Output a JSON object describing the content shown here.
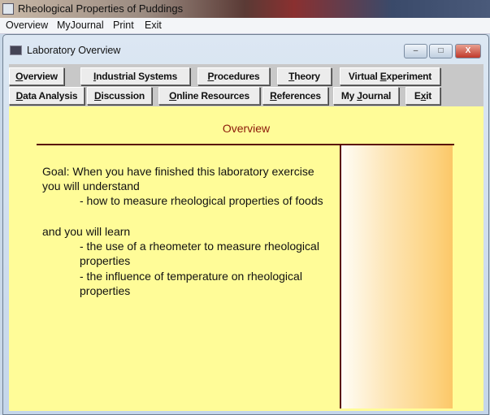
{
  "app": {
    "title": "Rheological Properties of Puddings",
    "icon": "app-icon"
  },
  "menu": [
    "Overview",
    "MyJournal",
    "Print",
    "Exit"
  ],
  "window": {
    "title": "Laboratory Overview",
    "controls": {
      "minimize": "–",
      "maximize": "□",
      "close": "X"
    }
  },
  "buttons": {
    "row1": [
      {
        "pre": "",
        "key": "O",
        "post": "verview"
      },
      {
        "pre": "",
        "key": "I",
        "post": "ndustrial Systems"
      },
      {
        "pre": "",
        "key": "P",
        "post": "rocedures"
      },
      {
        "pre": "",
        "key": "T",
        "post": "heory"
      },
      {
        "pre": "Virtual ",
        "key": "E",
        "post": "xperiment"
      }
    ],
    "row2": [
      {
        "pre": "",
        "key": "D",
        "post": "ata Analysis"
      },
      {
        "pre": "",
        "key": "D",
        "post": "iscussion"
      },
      {
        "pre": "",
        "key": "O",
        "post": "nline Resources"
      },
      {
        "pre": "",
        "key": "R",
        "post": "eferences"
      },
      {
        "pre": "My ",
        "key": "J",
        "post": "ournal"
      },
      {
        "pre": "E",
        "key": "x",
        "post": "it"
      }
    ]
  },
  "content": {
    "heading": "Overview",
    "lines": [
      "Goal:  When you have finished this laboratory exercise",
      "you will understand",
      "- how to measure rheological properties of foods",
      "and you will learn",
      "- the use of a rheometer to measure rheological",
      "properties",
      "- the influence of temperature on rheological",
      "properties"
    ]
  },
  "colors": {
    "content_bg": "#fffc98",
    "heading": "#8b1a0a",
    "rule": "#5a0c08"
  }
}
